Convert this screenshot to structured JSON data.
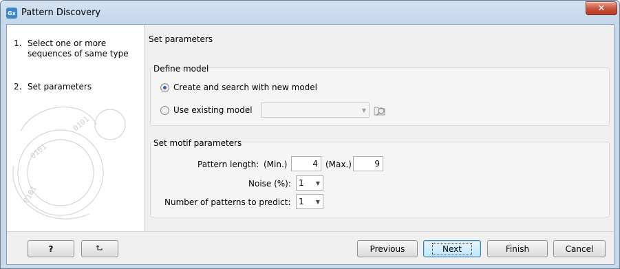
{
  "window": {
    "title": "Pattern Discovery",
    "app_icon_text": "Gx",
    "close_symbol": "✕"
  },
  "steps": [
    {
      "number": "1.",
      "label": "Select one or more sequences of same type"
    },
    {
      "number": "2.",
      "label": "Set parameters"
    }
  ],
  "main": {
    "heading": "Set parameters",
    "define_model": {
      "title": "Define model",
      "option_new": "Create and search with new model",
      "option_existing": "Use existing model",
      "selected": "option_new",
      "existing_model_value": ""
    },
    "motif": {
      "title": "Set motif parameters",
      "pattern_length_label": "Pattern length:",
      "min_label": "(Min.)",
      "min_value": "4",
      "max_label": "(Max.)",
      "max_value": "9",
      "noise_label": "Noise (%):",
      "noise_value": "1",
      "patterns_label": "Number of patterns to predict:",
      "patterns_value": "1"
    }
  },
  "buttons": {
    "help": "?",
    "previous": "Previous",
    "next": "Next",
    "finish": "Finish",
    "cancel": "Cancel"
  },
  "icons": {
    "help_button": "question-mark",
    "reset_button": "undo-arrow-icon",
    "browse": "folder-search-icon"
  }
}
